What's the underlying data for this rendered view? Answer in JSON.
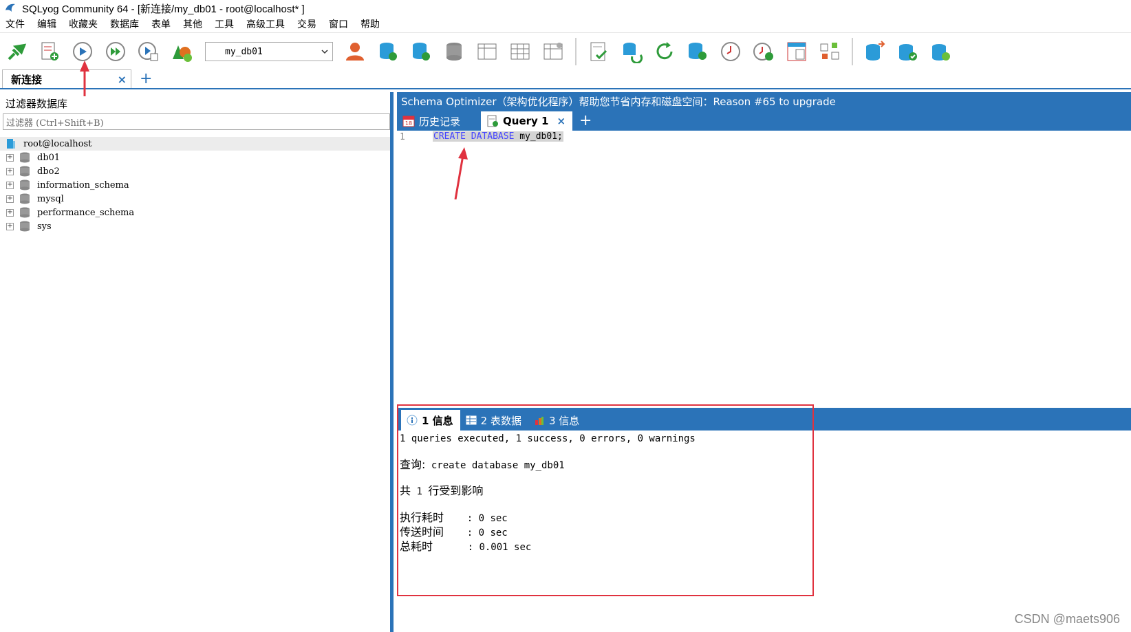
{
  "window": {
    "title": "SQLyog Community 64 - [新连接/my_db01 - root@localhost* ]"
  },
  "menu": [
    "文件",
    "编辑",
    "收藏夹",
    "数据库",
    "表单",
    "其他",
    "工具",
    "高级工具",
    "交易",
    "窗口",
    "帮助"
  ],
  "toolbar": {
    "database_selected": "my_db01"
  },
  "connection_tabs": {
    "active_label": "新连接",
    "close": "×",
    "add": "+"
  },
  "left_panel": {
    "filter_title": "过滤器数据库",
    "filter_placeholder": "过滤器 (Ctrl+Shift+B)",
    "root": "root@localhost",
    "databases": [
      "db01",
      "dbo2",
      "information_schema",
      "mysql",
      "performance_schema",
      "sys"
    ],
    "expander": "+"
  },
  "banner": {
    "text": "Schema Optimizer（架构优化程序）帮助您节省内存和磁盘空间：Reason #65 to upgrade"
  },
  "query_tabs": {
    "history_label": "历史记录",
    "history_icon_day": "18",
    "active_label": "Query 1",
    "close": "×",
    "add": "+"
  },
  "editor": {
    "line_number": "1",
    "keyword": "CREATE DATABASE",
    "rest": " my_db01;"
  },
  "result_tabs": {
    "tab1": "1 信息",
    "tab2": "2 表数据",
    "tab3": "3 信息"
  },
  "result": {
    "summary": "1 queries executed, 1 success, 0 errors, 0 warnings",
    "query_label": "查询:",
    "query_text": " create database my_db01",
    "affected_prefix": "共",
    "affected_count": " 1 ",
    "affected_suffix": "行受到影响",
    "exec_label": "执行耗时",
    "exec_value": "    : 0 sec",
    "transfer_label": "传送时间",
    "transfer_value": "    : 0 sec",
    "total_label": "总耗时",
    "total_value": "      : 0.001 sec"
  },
  "watermark": "CSDN @maets906",
  "colors": {
    "accent": "#2b73b8",
    "highlight": "#e0323f",
    "arrow": "#e0323f"
  }
}
